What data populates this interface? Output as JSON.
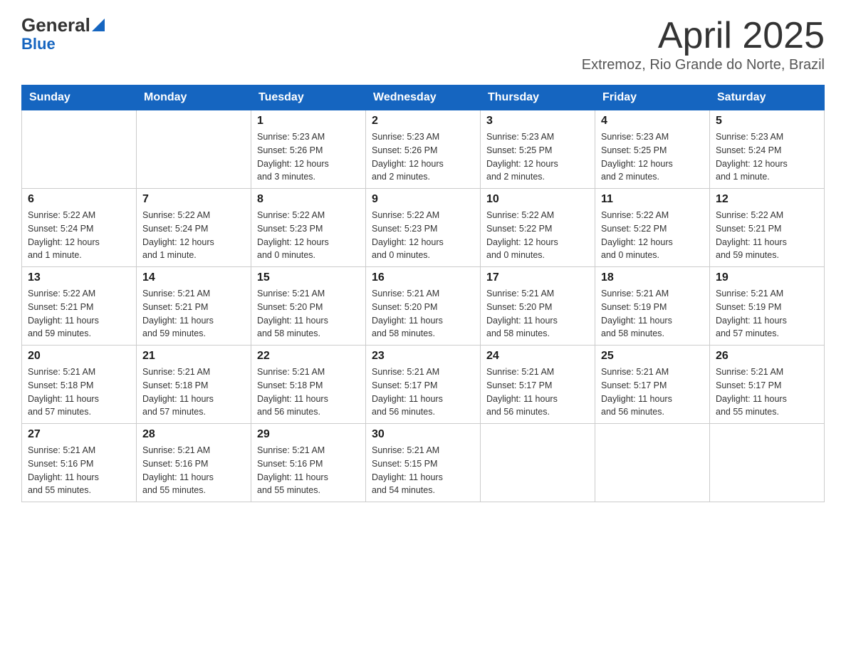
{
  "header": {
    "logo_line1": "General",
    "logo_line2": "Blue",
    "title": "April 2025",
    "subtitle": "Extremoz, Rio Grande do Norte, Brazil"
  },
  "weekdays": [
    "Sunday",
    "Monday",
    "Tuesday",
    "Wednesday",
    "Thursday",
    "Friday",
    "Saturday"
  ],
  "weeks": [
    [
      {
        "day": "",
        "info": ""
      },
      {
        "day": "",
        "info": ""
      },
      {
        "day": "1",
        "info": "Sunrise: 5:23 AM\nSunset: 5:26 PM\nDaylight: 12 hours\nand 3 minutes."
      },
      {
        "day": "2",
        "info": "Sunrise: 5:23 AM\nSunset: 5:26 PM\nDaylight: 12 hours\nand 2 minutes."
      },
      {
        "day": "3",
        "info": "Sunrise: 5:23 AM\nSunset: 5:25 PM\nDaylight: 12 hours\nand 2 minutes."
      },
      {
        "day": "4",
        "info": "Sunrise: 5:23 AM\nSunset: 5:25 PM\nDaylight: 12 hours\nand 2 minutes."
      },
      {
        "day": "5",
        "info": "Sunrise: 5:23 AM\nSunset: 5:24 PM\nDaylight: 12 hours\nand 1 minute."
      }
    ],
    [
      {
        "day": "6",
        "info": "Sunrise: 5:22 AM\nSunset: 5:24 PM\nDaylight: 12 hours\nand 1 minute."
      },
      {
        "day": "7",
        "info": "Sunrise: 5:22 AM\nSunset: 5:24 PM\nDaylight: 12 hours\nand 1 minute."
      },
      {
        "day": "8",
        "info": "Sunrise: 5:22 AM\nSunset: 5:23 PM\nDaylight: 12 hours\nand 0 minutes."
      },
      {
        "day": "9",
        "info": "Sunrise: 5:22 AM\nSunset: 5:23 PM\nDaylight: 12 hours\nand 0 minutes."
      },
      {
        "day": "10",
        "info": "Sunrise: 5:22 AM\nSunset: 5:22 PM\nDaylight: 12 hours\nand 0 minutes."
      },
      {
        "day": "11",
        "info": "Sunrise: 5:22 AM\nSunset: 5:22 PM\nDaylight: 12 hours\nand 0 minutes."
      },
      {
        "day": "12",
        "info": "Sunrise: 5:22 AM\nSunset: 5:21 PM\nDaylight: 11 hours\nand 59 minutes."
      }
    ],
    [
      {
        "day": "13",
        "info": "Sunrise: 5:22 AM\nSunset: 5:21 PM\nDaylight: 11 hours\nand 59 minutes."
      },
      {
        "day": "14",
        "info": "Sunrise: 5:21 AM\nSunset: 5:21 PM\nDaylight: 11 hours\nand 59 minutes."
      },
      {
        "day": "15",
        "info": "Sunrise: 5:21 AM\nSunset: 5:20 PM\nDaylight: 11 hours\nand 58 minutes."
      },
      {
        "day": "16",
        "info": "Sunrise: 5:21 AM\nSunset: 5:20 PM\nDaylight: 11 hours\nand 58 minutes."
      },
      {
        "day": "17",
        "info": "Sunrise: 5:21 AM\nSunset: 5:20 PM\nDaylight: 11 hours\nand 58 minutes."
      },
      {
        "day": "18",
        "info": "Sunrise: 5:21 AM\nSunset: 5:19 PM\nDaylight: 11 hours\nand 58 minutes."
      },
      {
        "day": "19",
        "info": "Sunrise: 5:21 AM\nSunset: 5:19 PM\nDaylight: 11 hours\nand 57 minutes."
      }
    ],
    [
      {
        "day": "20",
        "info": "Sunrise: 5:21 AM\nSunset: 5:18 PM\nDaylight: 11 hours\nand 57 minutes."
      },
      {
        "day": "21",
        "info": "Sunrise: 5:21 AM\nSunset: 5:18 PM\nDaylight: 11 hours\nand 57 minutes."
      },
      {
        "day": "22",
        "info": "Sunrise: 5:21 AM\nSunset: 5:18 PM\nDaylight: 11 hours\nand 56 minutes."
      },
      {
        "day": "23",
        "info": "Sunrise: 5:21 AM\nSunset: 5:17 PM\nDaylight: 11 hours\nand 56 minutes."
      },
      {
        "day": "24",
        "info": "Sunrise: 5:21 AM\nSunset: 5:17 PM\nDaylight: 11 hours\nand 56 minutes."
      },
      {
        "day": "25",
        "info": "Sunrise: 5:21 AM\nSunset: 5:17 PM\nDaylight: 11 hours\nand 56 minutes."
      },
      {
        "day": "26",
        "info": "Sunrise: 5:21 AM\nSunset: 5:17 PM\nDaylight: 11 hours\nand 55 minutes."
      }
    ],
    [
      {
        "day": "27",
        "info": "Sunrise: 5:21 AM\nSunset: 5:16 PM\nDaylight: 11 hours\nand 55 minutes."
      },
      {
        "day": "28",
        "info": "Sunrise: 5:21 AM\nSunset: 5:16 PM\nDaylight: 11 hours\nand 55 minutes."
      },
      {
        "day": "29",
        "info": "Sunrise: 5:21 AM\nSunset: 5:16 PM\nDaylight: 11 hours\nand 55 minutes."
      },
      {
        "day": "30",
        "info": "Sunrise: 5:21 AM\nSunset: 5:15 PM\nDaylight: 11 hours\nand 54 minutes."
      },
      {
        "day": "",
        "info": ""
      },
      {
        "day": "",
        "info": ""
      },
      {
        "day": "",
        "info": ""
      }
    ]
  ],
  "colors": {
    "header_bg": "#1565c0",
    "header_text": "#ffffff",
    "border": "#cccccc",
    "logo_dark": "#333333",
    "logo_blue": "#1565c0"
  }
}
